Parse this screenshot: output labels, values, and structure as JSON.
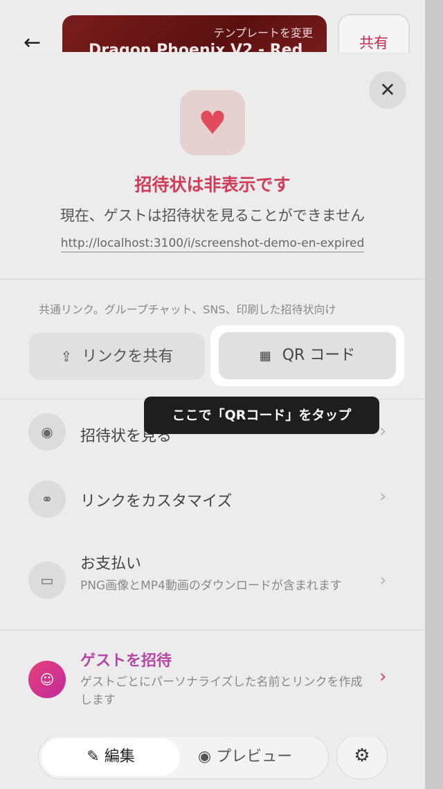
{
  "background": {
    "back_icon": "arrow-left-icon",
    "template_hint": "テンプレートを変更",
    "template_name": "Dragon Phoenix V2 - Red",
    "share_label": "共有",
    "edit_label": "編集",
    "preview_label": "プレビュー",
    "settings_icon": "gear-icon"
  },
  "modal": {
    "close_icon": "close-icon",
    "status_icon": "heart-icon",
    "status_title": "招待状は非表示です",
    "status_desc": "現在、ゲストは招待状を見ることができません",
    "url": "http://localhost:3100/i/screenshot-demo-en-expired",
    "share_caption": "共通リンク。グループチャット、SNS、印刷した招待状向け",
    "share_link_label": "リンクを共有",
    "qr_label": "QR コード",
    "tooltip": "ここで「QRコード」をタップ",
    "rows": [
      {
        "label": "招待状を見る",
        "icon": "eye-icon"
      },
      {
        "label": "リンクをカスタマイズ",
        "icon": "link-icon"
      },
      {
        "label": "お支払い",
        "sub": "PNG画像とMP4動画のダウンロードが含まれます",
        "icon": "card-icon"
      },
      {
        "label": "ゲストを招待",
        "sub": "ゲストごとにパーソナライズした名前とリンクを作成します",
        "icon": "users-icon"
      }
    ]
  },
  "colors": {
    "accent_pink": "#d03c58",
    "guest_purple": "#b646a3"
  }
}
